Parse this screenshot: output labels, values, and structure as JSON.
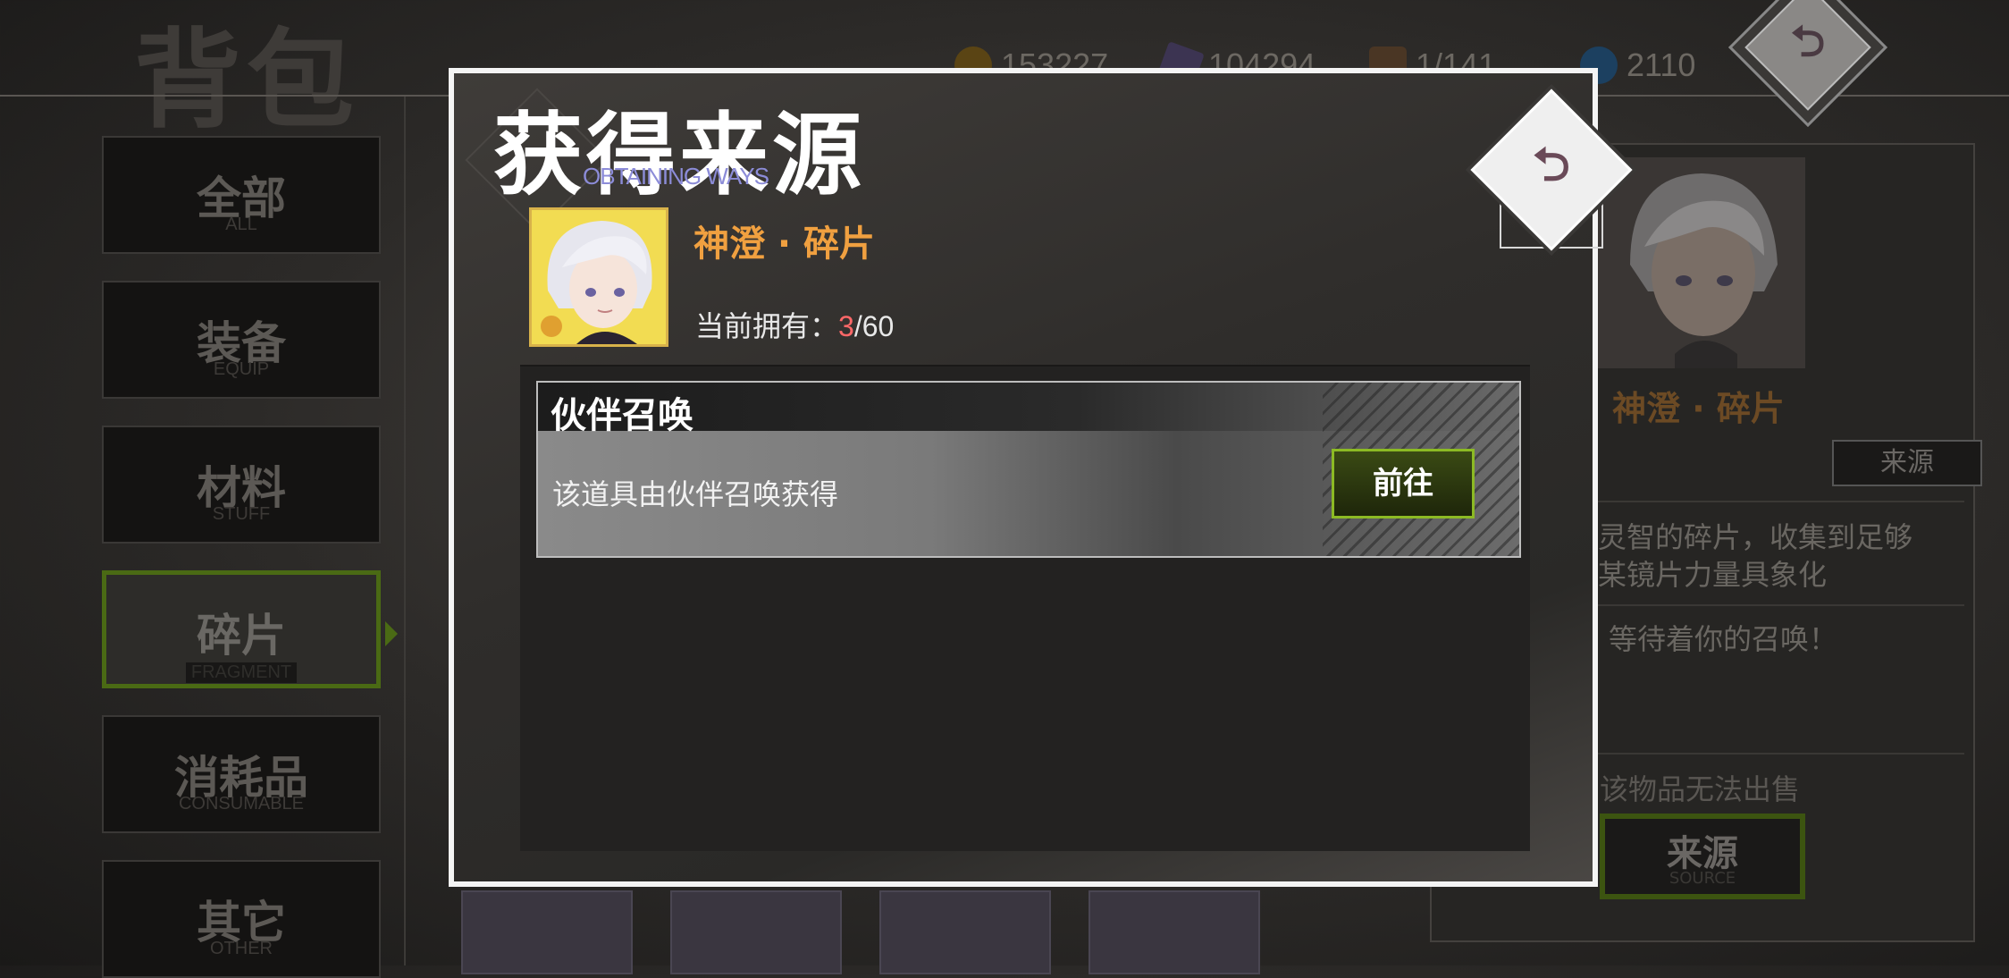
{
  "background": {
    "title": "背包",
    "resources": [
      {
        "icon": "gold-coin-icon",
        "value": "153227",
        "color": "#8a6a20"
      },
      {
        "icon": "crystal-icon",
        "value": "104294",
        "color": "#5a4a7a"
      },
      {
        "icon": "bag-capacity-icon",
        "value": "1/141",
        "color": "#7a5a3a"
      },
      {
        "icon": "diamond-icon",
        "value": "2110",
        "color": "#2a5a8a"
      }
    ],
    "categories": [
      {
        "zh": "全部",
        "en": "ALL"
      },
      {
        "zh": "装备",
        "en": "EQUIP"
      },
      {
        "zh": "材料",
        "en": "STUFF"
      },
      {
        "zh": "碎片",
        "en": "FRAGMENT"
      },
      {
        "zh": "消耗品",
        "en": "CONSUMABLE"
      },
      {
        "zh": "其它",
        "en": "OTHER"
      }
    ],
    "active_category": "碎片",
    "right_panel": {
      "item_name": "神澄 · 碎片",
      "source_small_button": "来源",
      "desc_line1": "灵智的碎片，收集到足够",
      "desc_line2": "某镜片力量具象化",
      "desc_line3": "等待着你的召唤！",
      "no_sell": "该物品无法出售",
      "source_button_zh": "来源",
      "source_button_en": "SOURCE"
    }
  },
  "modal": {
    "title": "获得来源",
    "subtitle": "OBTAINING WAYS",
    "item_name": "神澄 · 碎片",
    "owned_label": "当前拥有：",
    "owned_current": "3",
    "owned_max": "/60",
    "sources": [
      {
        "title": "伙伴召唤",
        "description": "该道具由伙伴召唤获得",
        "button": "前往"
      }
    ]
  },
  "colors": {
    "accent_green": "#8cba24",
    "item_name_orange": "#f0a040",
    "owned_red": "#ff6868",
    "subtitle_blue": "#8c8cd8"
  }
}
